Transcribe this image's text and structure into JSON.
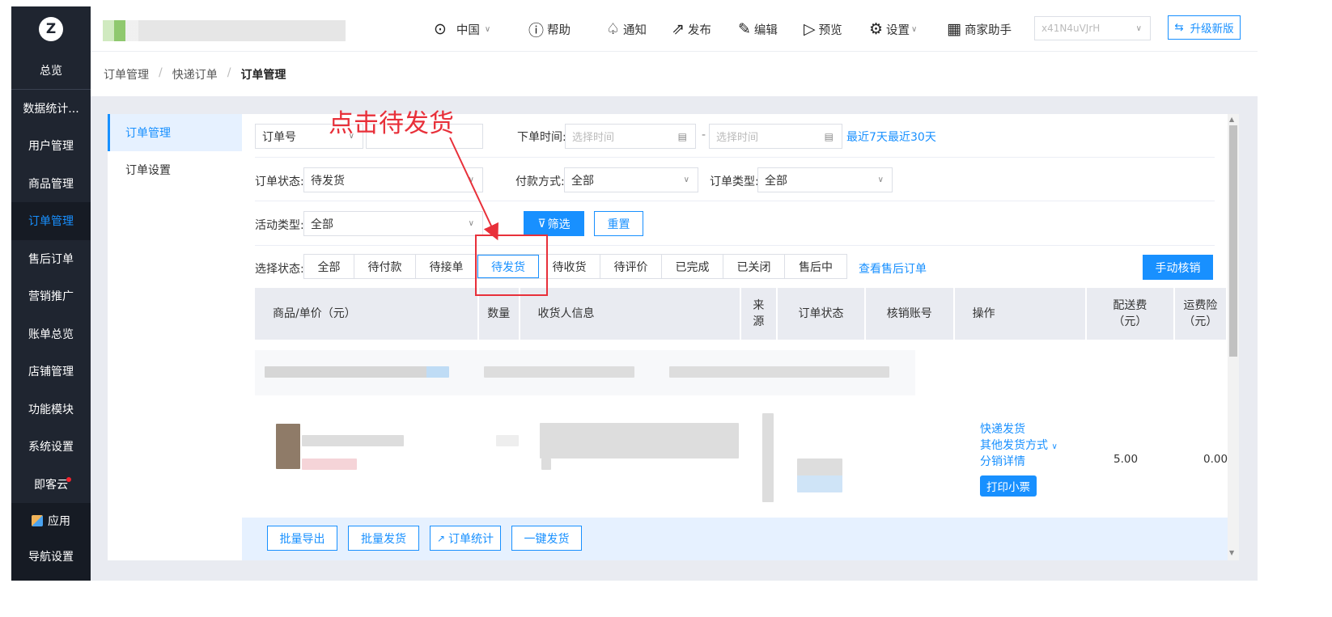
{
  "sidebar": {
    "logo": "Z",
    "items": [
      "总览",
      "数据统计...",
      "用户管理",
      "商品管理",
      "订单管理",
      "售后订单",
      "营销推广",
      "账单总览",
      "店铺管理",
      "功能模块",
      "系统设置",
      "即客云"
    ],
    "bottom": [
      "应用",
      "导航设置"
    ]
  },
  "topbar": {
    "region": "中国",
    "help": "帮助",
    "notify": "通知",
    "publish": "发布",
    "edit": "编辑",
    "preview": "预览",
    "settings": "设置",
    "merchant": "商家助手",
    "store_select": "x41N4uVJrH",
    "upgrade": "升级新版"
  },
  "breadcrumb": [
    "订单管理",
    "快递订单",
    "订单管理"
  ],
  "subnav": [
    "订单管理",
    "订单设置"
  ],
  "filters": {
    "order_no_type": "订单号",
    "order_time_label": "下单时间:",
    "time_placeholder": "选择时间",
    "time_sep": "-",
    "last7": "最近7天",
    "last30": "最近30天",
    "status_label": "订单状态:",
    "status_value": "待发货",
    "pay_label": "付款方式:",
    "pay_value": "全部",
    "type_label": "订单类型:",
    "type_value": "全部",
    "activity_label": "活动类型:",
    "activity_value": "全部",
    "filter_btn": "筛选",
    "reset_btn": "重置"
  },
  "status_tabs": {
    "label": "选择状态:",
    "items": [
      "全部",
      "待付款",
      "待接单",
      "待发货",
      "待收货",
      "待评价",
      "已完成",
      "已关闭",
      "售后中"
    ],
    "selected": "待发货",
    "aftersale_link": "查看售后订单",
    "manual_btn": "手动核销"
  },
  "table": {
    "headers": [
      "商品/单价（元）",
      "数量",
      "收货人信息",
      "来\n源",
      "订单状态",
      "核销账号",
      "操作",
      "配送费\n（元）",
      "运费险\n（元）"
    ],
    "row": {
      "ops": [
        "快递发货",
        "其他发货方式",
        "分销详情"
      ],
      "print": "打印小票",
      "delivery_fee": "5.00",
      "insurance_fee": "0.00"
    }
  },
  "bottom_bar": [
    "批量导出",
    "批量发货",
    "订单统计",
    "一键发货"
  ],
  "annotation": {
    "text": "点击待发货",
    "color": "#e8303a"
  },
  "colors": {
    "accent": "#1890ff",
    "sidebar_bg": "#1f2530"
  }
}
